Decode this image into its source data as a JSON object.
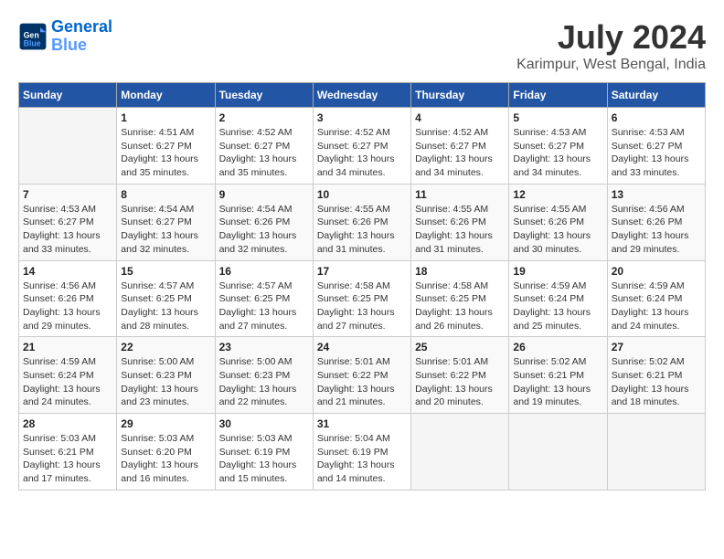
{
  "header": {
    "logo_line1": "General",
    "logo_line2": "Blue",
    "title": "July 2024",
    "subtitle": "Karimpur, West Bengal, India"
  },
  "weekdays": [
    "Sunday",
    "Monday",
    "Tuesday",
    "Wednesday",
    "Thursday",
    "Friday",
    "Saturday"
  ],
  "weeks": [
    [
      {
        "day": "",
        "info": ""
      },
      {
        "day": "1",
        "info": "Sunrise: 4:51 AM\nSunset: 6:27 PM\nDaylight: 13 hours\nand 35 minutes."
      },
      {
        "day": "2",
        "info": "Sunrise: 4:52 AM\nSunset: 6:27 PM\nDaylight: 13 hours\nand 35 minutes."
      },
      {
        "day": "3",
        "info": "Sunrise: 4:52 AM\nSunset: 6:27 PM\nDaylight: 13 hours\nand 34 minutes."
      },
      {
        "day": "4",
        "info": "Sunrise: 4:52 AM\nSunset: 6:27 PM\nDaylight: 13 hours\nand 34 minutes."
      },
      {
        "day": "5",
        "info": "Sunrise: 4:53 AM\nSunset: 6:27 PM\nDaylight: 13 hours\nand 34 minutes."
      },
      {
        "day": "6",
        "info": "Sunrise: 4:53 AM\nSunset: 6:27 PM\nDaylight: 13 hours\nand 33 minutes."
      }
    ],
    [
      {
        "day": "7",
        "info": "Sunrise: 4:53 AM\nSunset: 6:27 PM\nDaylight: 13 hours\nand 33 minutes."
      },
      {
        "day": "8",
        "info": "Sunrise: 4:54 AM\nSunset: 6:27 PM\nDaylight: 13 hours\nand 32 minutes."
      },
      {
        "day": "9",
        "info": "Sunrise: 4:54 AM\nSunset: 6:26 PM\nDaylight: 13 hours\nand 32 minutes."
      },
      {
        "day": "10",
        "info": "Sunrise: 4:55 AM\nSunset: 6:26 PM\nDaylight: 13 hours\nand 31 minutes."
      },
      {
        "day": "11",
        "info": "Sunrise: 4:55 AM\nSunset: 6:26 PM\nDaylight: 13 hours\nand 31 minutes."
      },
      {
        "day": "12",
        "info": "Sunrise: 4:55 AM\nSunset: 6:26 PM\nDaylight: 13 hours\nand 30 minutes."
      },
      {
        "day": "13",
        "info": "Sunrise: 4:56 AM\nSunset: 6:26 PM\nDaylight: 13 hours\nand 29 minutes."
      }
    ],
    [
      {
        "day": "14",
        "info": "Sunrise: 4:56 AM\nSunset: 6:26 PM\nDaylight: 13 hours\nand 29 minutes."
      },
      {
        "day": "15",
        "info": "Sunrise: 4:57 AM\nSunset: 6:25 PM\nDaylight: 13 hours\nand 28 minutes."
      },
      {
        "day": "16",
        "info": "Sunrise: 4:57 AM\nSunset: 6:25 PM\nDaylight: 13 hours\nand 27 minutes."
      },
      {
        "day": "17",
        "info": "Sunrise: 4:58 AM\nSunset: 6:25 PM\nDaylight: 13 hours\nand 27 minutes."
      },
      {
        "day": "18",
        "info": "Sunrise: 4:58 AM\nSunset: 6:25 PM\nDaylight: 13 hours\nand 26 minutes."
      },
      {
        "day": "19",
        "info": "Sunrise: 4:59 AM\nSunset: 6:24 PM\nDaylight: 13 hours\nand 25 minutes."
      },
      {
        "day": "20",
        "info": "Sunrise: 4:59 AM\nSunset: 6:24 PM\nDaylight: 13 hours\nand 24 minutes."
      }
    ],
    [
      {
        "day": "21",
        "info": "Sunrise: 4:59 AM\nSunset: 6:24 PM\nDaylight: 13 hours\nand 24 minutes."
      },
      {
        "day": "22",
        "info": "Sunrise: 5:00 AM\nSunset: 6:23 PM\nDaylight: 13 hours\nand 23 minutes."
      },
      {
        "day": "23",
        "info": "Sunrise: 5:00 AM\nSunset: 6:23 PM\nDaylight: 13 hours\nand 22 minutes."
      },
      {
        "day": "24",
        "info": "Sunrise: 5:01 AM\nSunset: 6:22 PM\nDaylight: 13 hours\nand 21 minutes."
      },
      {
        "day": "25",
        "info": "Sunrise: 5:01 AM\nSunset: 6:22 PM\nDaylight: 13 hours\nand 20 minutes."
      },
      {
        "day": "26",
        "info": "Sunrise: 5:02 AM\nSunset: 6:21 PM\nDaylight: 13 hours\nand 19 minutes."
      },
      {
        "day": "27",
        "info": "Sunrise: 5:02 AM\nSunset: 6:21 PM\nDaylight: 13 hours\nand 18 minutes."
      }
    ],
    [
      {
        "day": "28",
        "info": "Sunrise: 5:03 AM\nSunset: 6:21 PM\nDaylight: 13 hours\nand 17 minutes."
      },
      {
        "day": "29",
        "info": "Sunrise: 5:03 AM\nSunset: 6:20 PM\nDaylight: 13 hours\nand 16 minutes."
      },
      {
        "day": "30",
        "info": "Sunrise: 5:03 AM\nSunset: 6:19 PM\nDaylight: 13 hours\nand 15 minutes."
      },
      {
        "day": "31",
        "info": "Sunrise: 5:04 AM\nSunset: 6:19 PM\nDaylight: 13 hours\nand 14 minutes."
      },
      {
        "day": "",
        "info": ""
      },
      {
        "day": "",
        "info": ""
      },
      {
        "day": "",
        "info": ""
      }
    ]
  ]
}
